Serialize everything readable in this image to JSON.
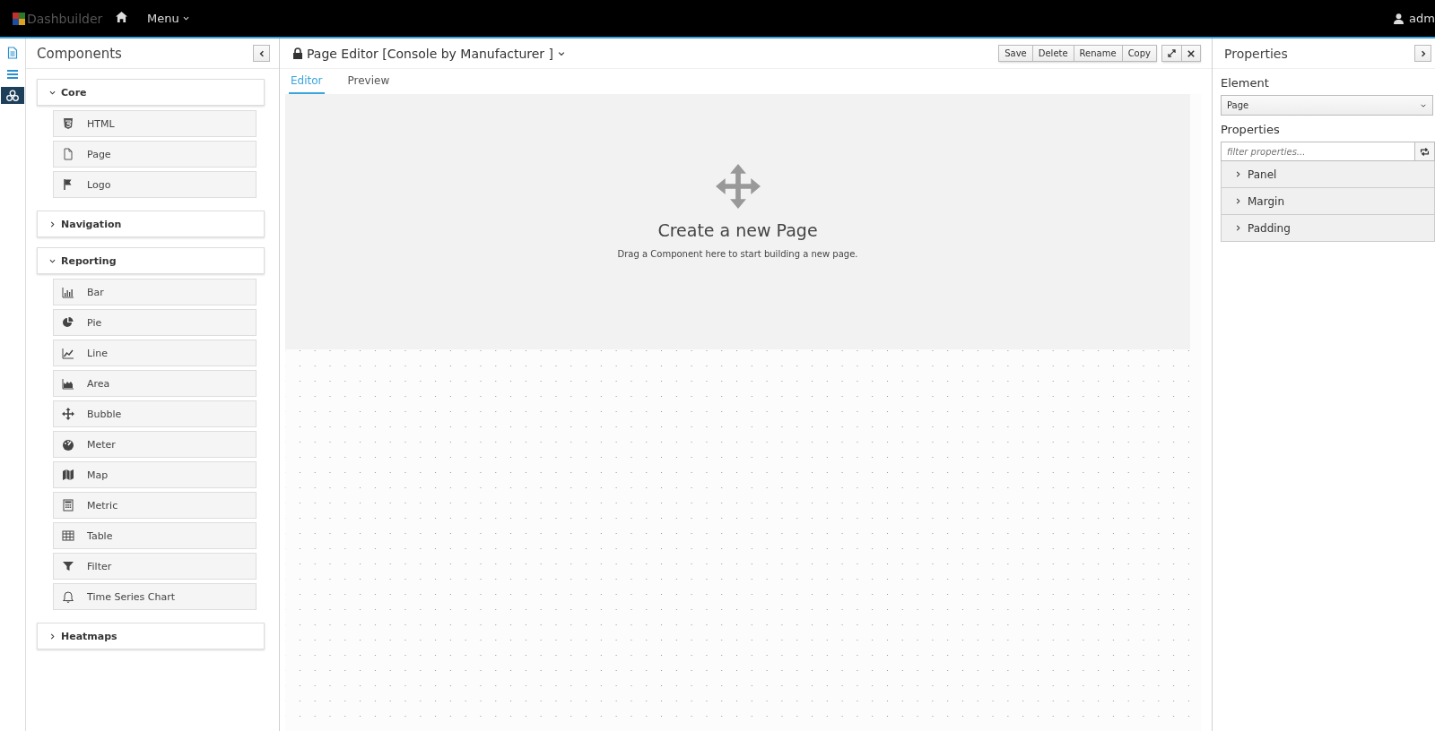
{
  "topbar": {
    "brand": "Dashbuilder",
    "menu": "Menu",
    "user": "adm"
  },
  "rail": [
    {
      "selected": false
    },
    {
      "selected": false
    },
    {
      "selected": true
    }
  ],
  "components": {
    "title": "Components",
    "groups": [
      {
        "label": "Core",
        "expanded": true,
        "items": [
          "HTML",
          "Page",
          "Logo"
        ]
      },
      {
        "label": "Navigation",
        "expanded": false
      },
      {
        "label": "Reporting",
        "expanded": true,
        "items": [
          "Bar",
          "Pie",
          "Line",
          "Area",
          "Bubble",
          "Meter",
          "Map",
          "Metric",
          "Table",
          "Filter",
          "Time Series Chart"
        ]
      },
      {
        "label": "Heatmaps",
        "expanded": false
      }
    ]
  },
  "editor": {
    "title": "Page Editor [Console by Manufacturer ]",
    "buttons": [
      "Save",
      "Delete",
      "Rename",
      "Copy"
    ],
    "tabs": [
      {
        "label": "Editor",
        "selected": true
      },
      {
        "label": "Preview",
        "selected": false
      }
    ],
    "empty": {
      "heading": "Create a new Page",
      "text": "Drag a Component here to start building a new page."
    }
  },
  "properties": {
    "title": "Properties",
    "element_label": "Element",
    "element_value": "Page",
    "properties_label": "Properties",
    "filter": {
      "placeholder": "filter properties..."
    },
    "sections": [
      {
        "label": "Panel",
        "expanded": false
      },
      {
        "label": "Margin",
        "expanded": false
      },
      {
        "label": "Padding",
        "expanded": false
      }
    ]
  }
}
